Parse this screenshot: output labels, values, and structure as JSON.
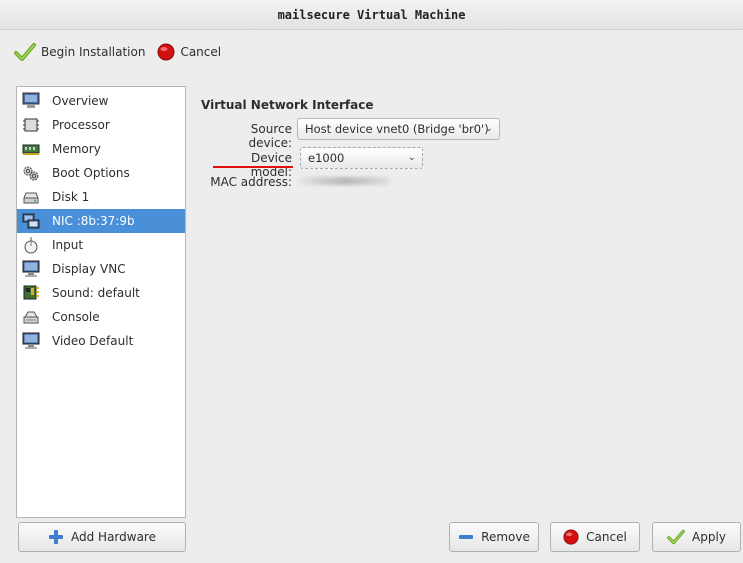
{
  "window": {
    "title": "mailsecure Virtual Machine"
  },
  "toolbar": {
    "begin_label": "Begin Installation",
    "cancel_label": "Cancel"
  },
  "sidebar": {
    "items": [
      {
        "label": "Overview",
        "icon": "monitor-icon"
      },
      {
        "label": "Processor",
        "icon": "chip-icon"
      },
      {
        "label": "Memory",
        "icon": "memory-icon"
      },
      {
        "label": "Boot Options",
        "icon": "gears-icon"
      },
      {
        "label": "Disk 1",
        "icon": "disk-icon"
      },
      {
        "label": "NIC :8b:37:9b",
        "icon": "network-icon",
        "selected": true
      },
      {
        "label": "Input",
        "icon": "mouse-icon"
      },
      {
        "label": "Display VNC",
        "icon": "display-icon"
      },
      {
        "label": "Sound: default",
        "icon": "sound-card-icon"
      },
      {
        "label": "Console",
        "icon": "console-icon"
      },
      {
        "label": "Video Default",
        "icon": "video-icon"
      }
    ]
  },
  "nic": {
    "section_title": "Virtual Network Interface",
    "source_label": "Source device:",
    "source_value": "Host device vnet0 (Bridge 'br0')",
    "model_label": "Device model:",
    "model_value": "e1000",
    "mac_label": "MAC address:"
  },
  "buttons": {
    "add_hardware": "Add Hardware",
    "remove": "Remove",
    "cancel": "Cancel",
    "apply": "Apply"
  },
  "colors": {
    "selection": "#4a90d9",
    "highlight_underline": "#e01010"
  }
}
